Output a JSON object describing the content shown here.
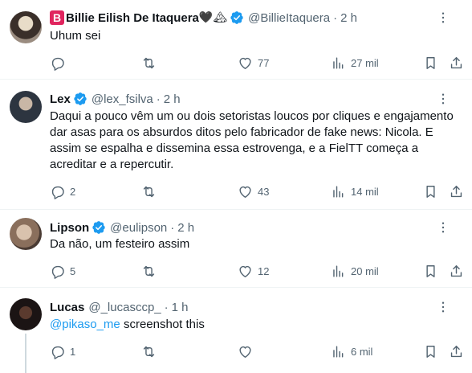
{
  "tweets": [
    {
      "name": "Billie Eilish De Itaquera",
      "name_prefix": "B",
      "name_suffix": "🖤🏔",
      "verified": true,
      "handle": "@BillieItaquera",
      "dot": "·",
      "time": "2 h",
      "text": "Uhum sei",
      "replies": "",
      "retweets": "",
      "likes": "77",
      "views": "27 mil"
    },
    {
      "name": "Lex",
      "verified": true,
      "handle": "@lex_fsilva",
      "dot": "·",
      "time": "2 h",
      "text": "Daqui a pouco vêm um ou dois setoristas loucos por cliques e engajamento dar asas para os absurdos ditos pelo fabricador de fake news: Nicola. E assim se espalha e dissemina essa estrovenga, e a FielTT começa a acreditar e a repercutir.",
      "replies": "2",
      "retweets": "",
      "likes": "43",
      "views": "14 mil"
    },
    {
      "name": "Lipson",
      "verified": true,
      "handle": "@eulipson",
      "dot": "·",
      "time": "2 h",
      "text": "Da não, um festeiro assim",
      "replies": "5",
      "retweets": "",
      "likes": "12",
      "views": "20 mil"
    },
    {
      "name": "Lucas",
      "verified": false,
      "handle": "@_lucasccp_",
      "dot": "·",
      "time": "1 h",
      "mention": "@pikaso_me",
      "text": " screenshot this",
      "replies": "1",
      "retweets": "",
      "likes": "",
      "views": "6 mil"
    }
  ],
  "colors": {
    "accent": "#1d9bf0",
    "text": "#0f1419",
    "muted": "#536471",
    "divider": "#eff3f4",
    "badge_red": "#e0245e"
  },
  "icons": [
    "more-icon",
    "reply-icon",
    "retweet-icon",
    "like-icon",
    "views-icon",
    "bookmark-icon",
    "share-icon",
    "verified-badge-icon"
  ]
}
